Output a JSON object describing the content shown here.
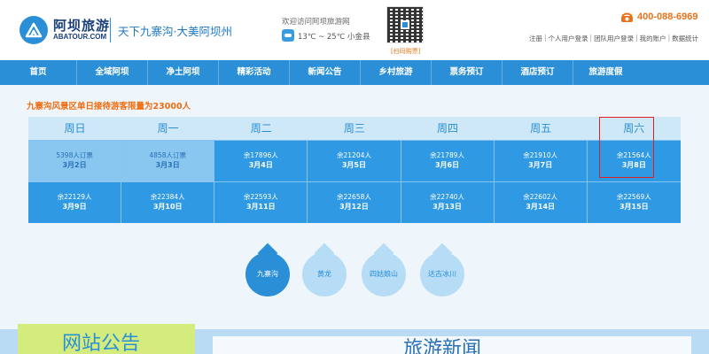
{
  "header": {
    "brand_cn": "阿坝旅游",
    "brand_en": "ABATOUR.COM",
    "slogan": "天下九寨沟·大美阿坝州",
    "welcome": "欢迎访问阿坝旅游网",
    "weather": "13℃ ~ 25℃ 小金县",
    "qr_caption": "[扫码购票]",
    "phone": "400-088-6969",
    "links": [
      "注册",
      "个人用户登录",
      "团队用户登录",
      "我的账户",
      "数据统计"
    ],
    "link_separator": "|"
  },
  "nav": [
    "首页",
    "全域阿坝",
    "净土阿坝",
    "精彩活动",
    "新闻公告",
    "乡村旅游",
    "票务预订",
    "酒店预订",
    "旅游度假"
  ],
  "notice": "九寨沟风景区单日接待游客限量为23000人",
  "calendar": {
    "weekdays": [
      "周日",
      "周一",
      "周二",
      "周三",
      "周四",
      "周五",
      "周六"
    ],
    "week1": [
      {
        "remain": "5398人订票",
        "date": "3月2日"
      },
      {
        "remain": "4858人订票",
        "date": "3月3日"
      },
      {
        "remain": "余17896人",
        "date": "3月4日"
      },
      {
        "remain": "余21204人",
        "date": "3月5日"
      },
      {
        "remain": "余21789人",
        "date": "3月6日"
      },
      {
        "remain": "余21910人",
        "date": "3月7日"
      },
      {
        "remain": "余21564人",
        "date": "3月8日"
      }
    ],
    "week2": [
      {
        "remain": "余22129人",
        "date": "3月9日"
      },
      {
        "remain": "余22384人",
        "date": "3月10日"
      },
      {
        "remain": "余22593人",
        "date": "3月11日"
      },
      {
        "remain": "余22658人",
        "date": "3月12日"
      },
      {
        "remain": "余22740人",
        "date": "3月13日"
      },
      {
        "remain": "余22602人",
        "date": "3月14日"
      },
      {
        "remain": "余22569人",
        "date": "3月15日"
      }
    ]
  },
  "scenic": [
    "九寨沟",
    "黄龙",
    "四姑娘山",
    "达古冰川"
  ],
  "bottom": {
    "notice_title": "网站公告",
    "news_title": "旅游新闻"
  },
  "colors": {
    "primary": "#2a8fd6",
    "accent": "#ee6d12",
    "highlight": "#e02020"
  }
}
